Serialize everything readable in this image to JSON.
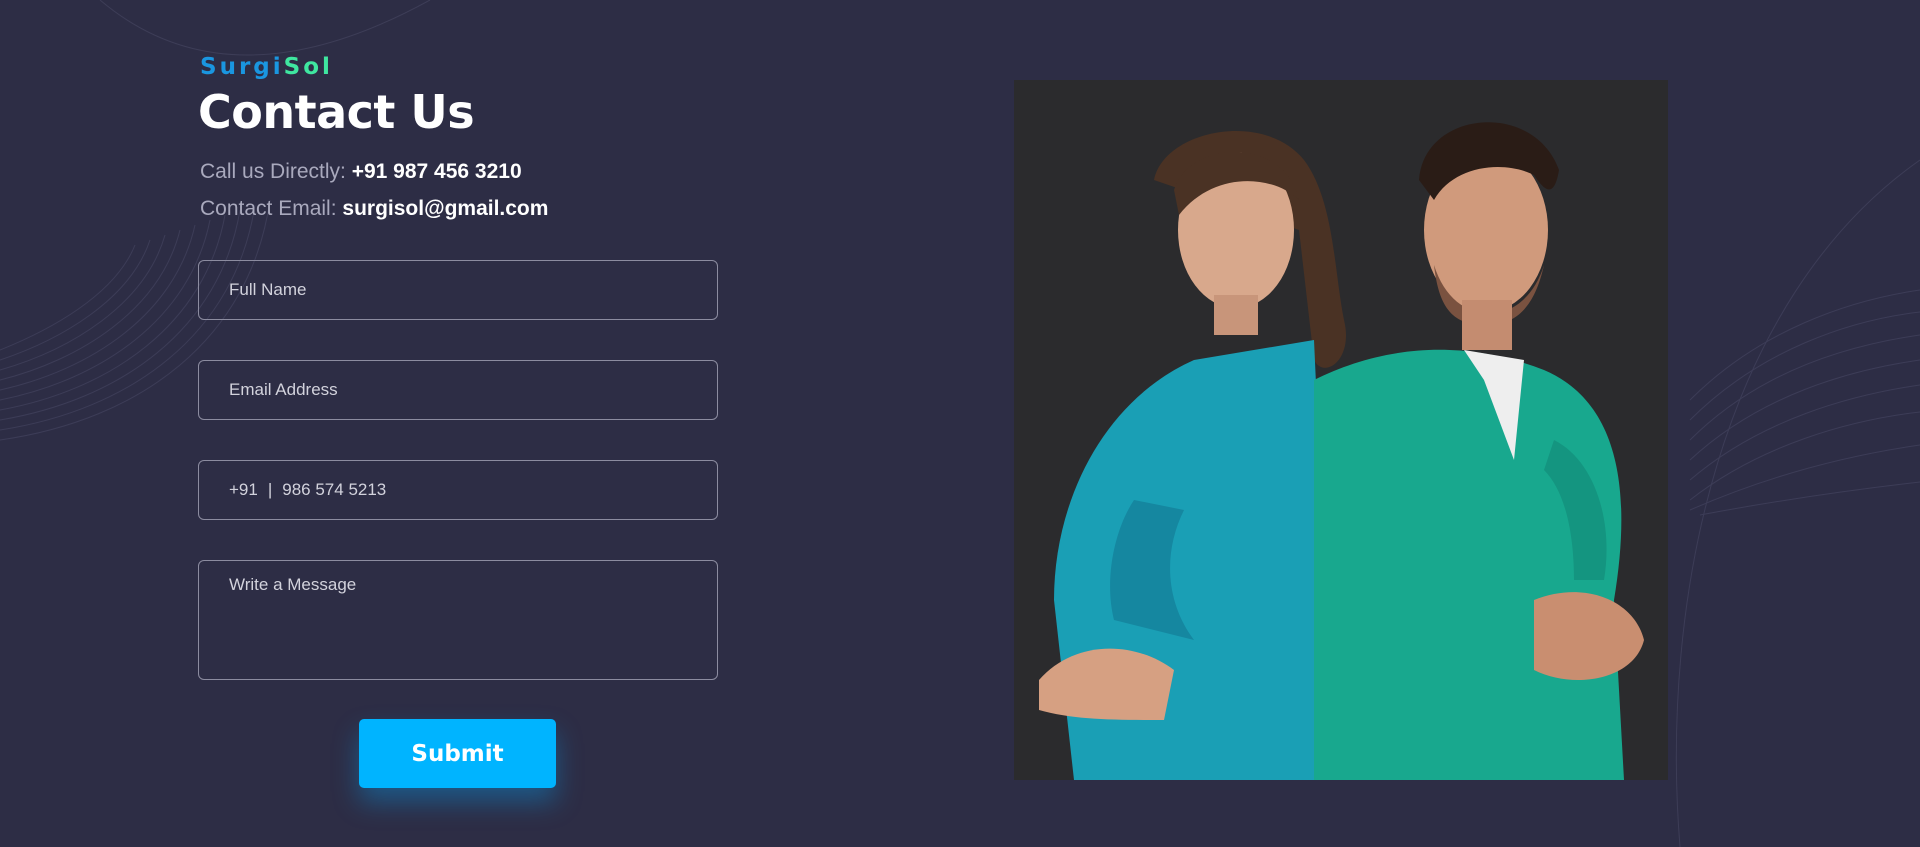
{
  "brand": {
    "part1": "Surgi",
    "part2": "Sol",
    "color1": "#1a96e0",
    "color2": "#3fe6a0"
  },
  "page": {
    "title": "Contact Us"
  },
  "contact": {
    "phone_label": "Call us Directly:",
    "phone_value": "+91 987 456 3210",
    "email_label": "Contact Email:",
    "email_value": "surgisol@gmail.com"
  },
  "form": {
    "name_placeholder": "Full Name",
    "email_placeholder": "Email Address",
    "phone_code": "+91",
    "phone_separator": "|",
    "phone_placeholder": "986 574 5213",
    "message_placeholder": "Write a Message",
    "submit_label": "Submit"
  },
  "colors": {
    "background": "#2d2d45",
    "accent": "#00b4ff",
    "scrub_blue": "#1a9fb5",
    "scrub_green": "#18a88e"
  },
  "image": {
    "subject": "two medical professionals in scrubs standing back to back"
  }
}
